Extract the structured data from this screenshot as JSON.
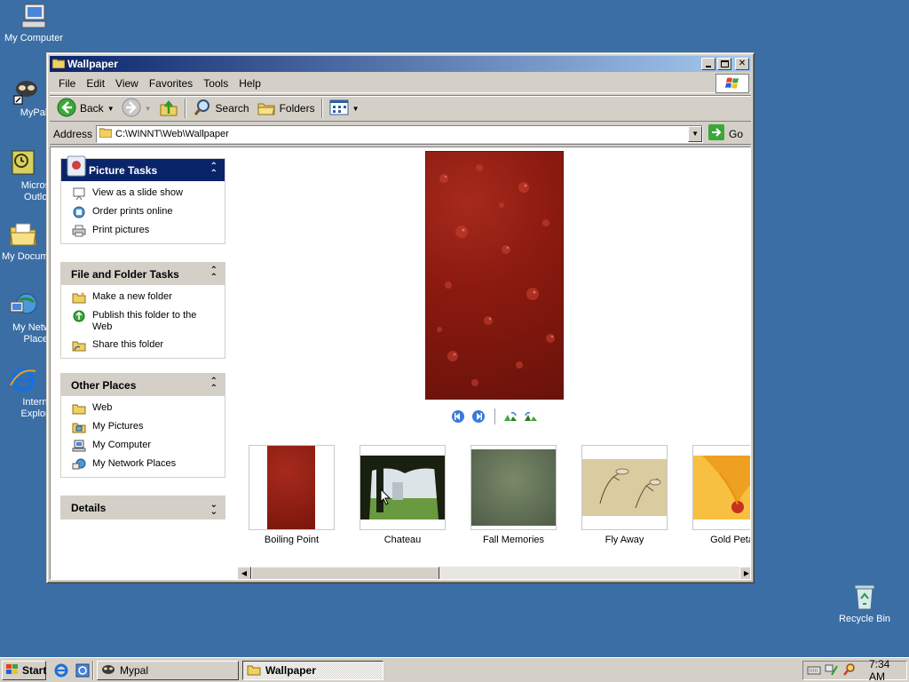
{
  "desktop": {
    "icons": [
      {
        "label": "My Computer",
        "icon": "my-computer-icon"
      },
      {
        "label": "MyPal",
        "icon": "mypal-icon"
      },
      {
        "label": "Microsoft Outlook",
        "icon": "outlook-icon"
      },
      {
        "label": "My Documents",
        "icon": "my-documents-icon"
      },
      {
        "label": "My Network Places",
        "icon": "network-places-icon"
      },
      {
        "label": "Internet Explorer",
        "icon": "internet-explorer-icon"
      },
      {
        "label": "Recycle Bin",
        "icon": "recycle-bin-icon"
      }
    ]
  },
  "window": {
    "title": "Wallpaper",
    "menu": [
      "File",
      "Edit",
      "View",
      "Favorites",
      "Tools",
      "Help"
    ],
    "toolbar": {
      "back_label": "Back",
      "search_label": "Search",
      "folders_label": "Folders"
    },
    "address": {
      "label": "Address",
      "value": "C:\\WINNT\\Web\\Wallpaper",
      "go_label": "Go"
    }
  },
  "taskpane": {
    "picture_tasks": {
      "title": "Picture Tasks",
      "items": [
        "View as a slide show",
        "Order prints online",
        "Print pictures"
      ]
    },
    "file_folder_tasks": {
      "title": "File and Folder Tasks",
      "items": [
        "Make a new folder",
        "Publish this folder to the Web",
        "Share this folder"
      ]
    },
    "other_places": {
      "title": "Other Places",
      "items": [
        "Web",
        "My Pictures",
        "My Computer",
        "My Network Places"
      ]
    },
    "details": {
      "title": "Details"
    }
  },
  "thumbnails": [
    {
      "name": "Boiling Point",
      "selected": true
    },
    {
      "name": "Chateau",
      "selected": false
    },
    {
      "name": "Fall Memories",
      "selected": false
    },
    {
      "name": "Fly Away",
      "selected": false
    },
    {
      "name": "Gold Petals",
      "selected": false
    }
  ],
  "taskbar": {
    "start_label": "Start",
    "tasks": [
      {
        "label": "Mypal",
        "active": false
      },
      {
        "label": "Wallpaper",
        "active": true
      }
    ],
    "clock": "7:34 AM"
  },
  "colors": {
    "desktop": "#3a6ea5",
    "titlebar_start": "#0a246a",
    "titlebar_end": "#a6caf0",
    "chrome": "#d4d0c8"
  }
}
